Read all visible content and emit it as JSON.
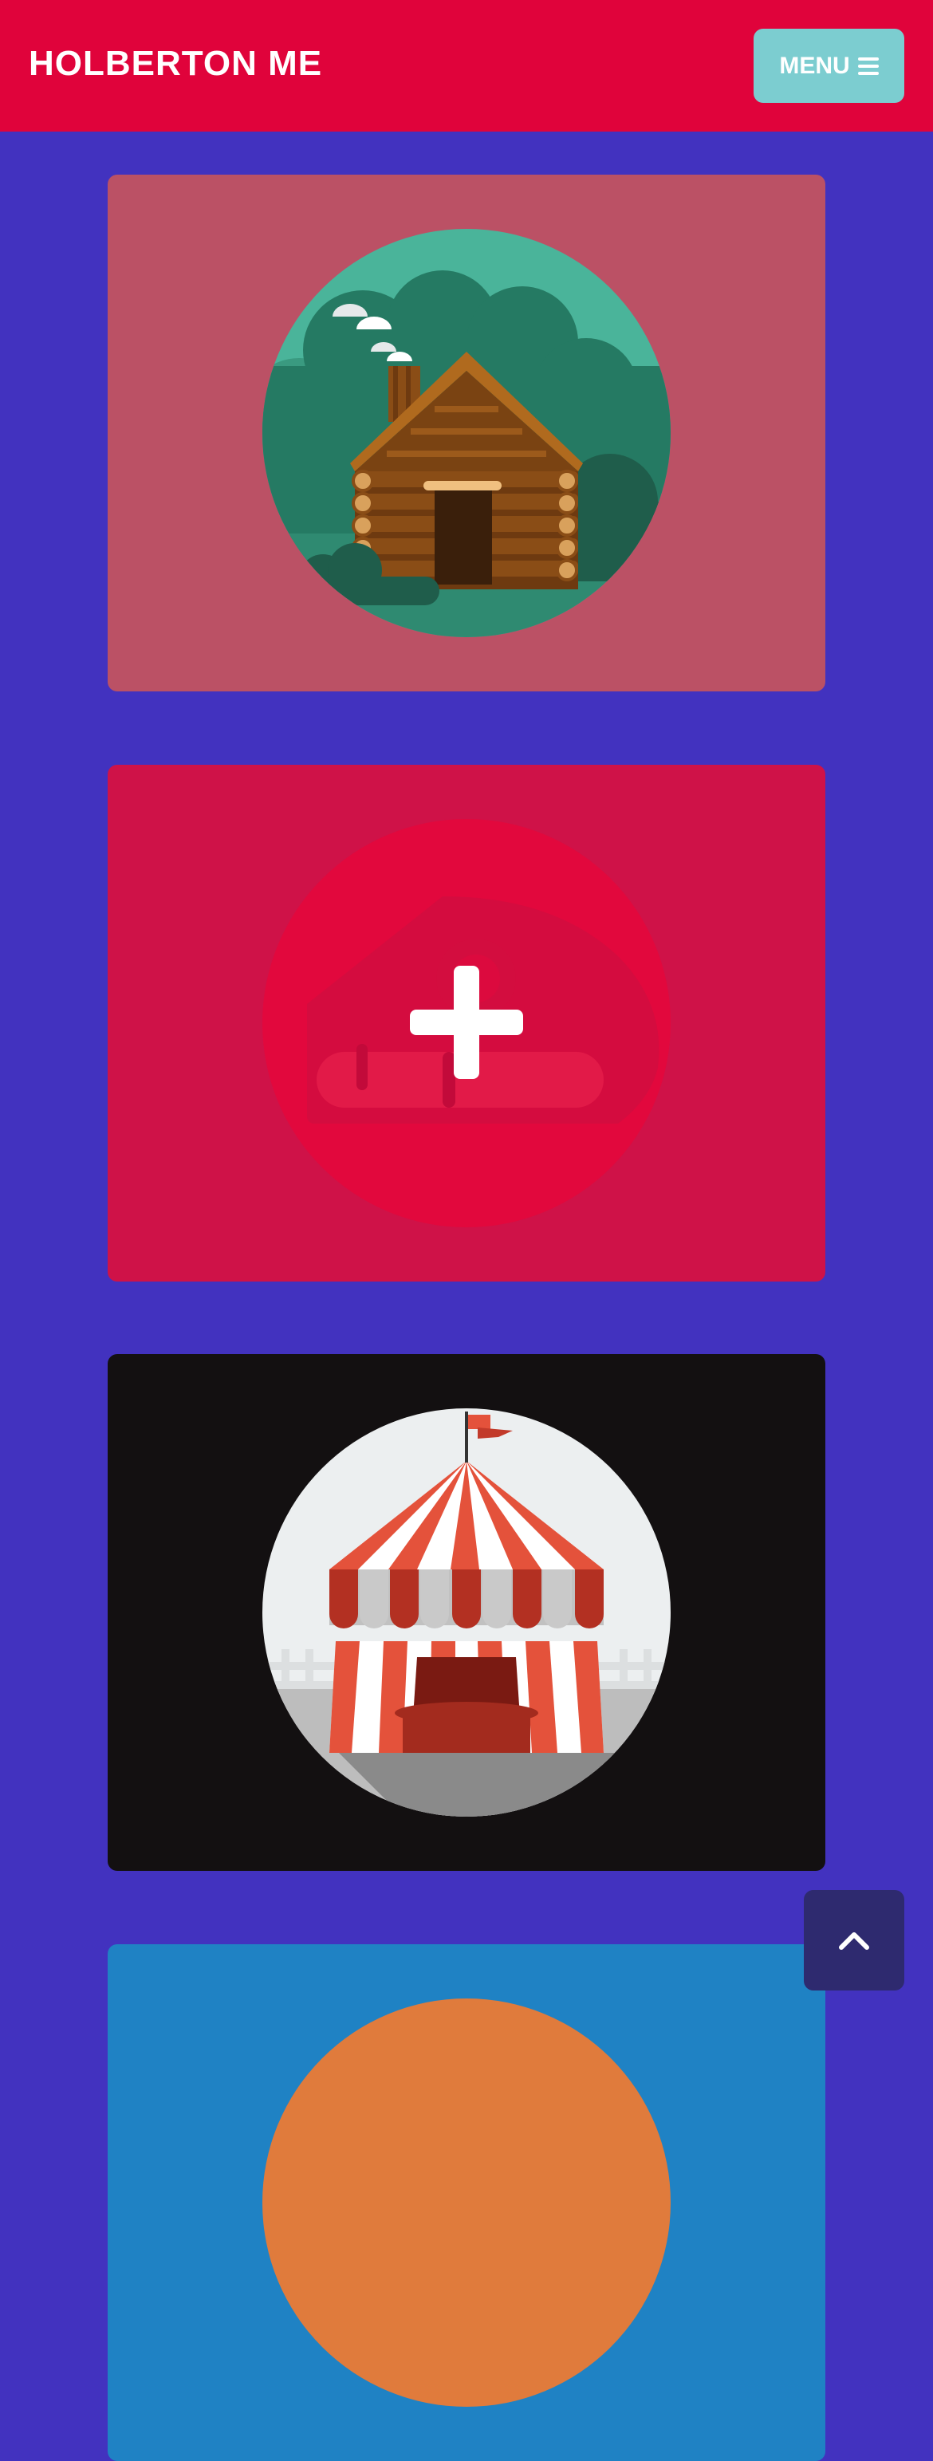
{
  "header": {
    "brand": "HOLBERTON ME",
    "menu_label": "MENU",
    "menu_icon": "hamburger-icon",
    "background": "#e0033b",
    "menu_background": "#7ccdd0"
  },
  "page": {
    "background": "#4232bf"
  },
  "cards": [
    {
      "name": "cabin",
      "illustration": "log-cabin-illustration",
      "background": "#bb5165"
    },
    {
      "name": "add",
      "illustration": "plus-icon",
      "background": "#cf1248",
      "state": "hover-overlay"
    },
    {
      "name": "circus",
      "illustration": "circus-tent-illustration",
      "background": "#131011"
    },
    {
      "name": "partial",
      "illustration": "sun-illustration",
      "background": "#1f82c4"
    }
  ],
  "scroll_top": {
    "icon": "chevron-up-icon",
    "background": "#2e2a6f"
  }
}
